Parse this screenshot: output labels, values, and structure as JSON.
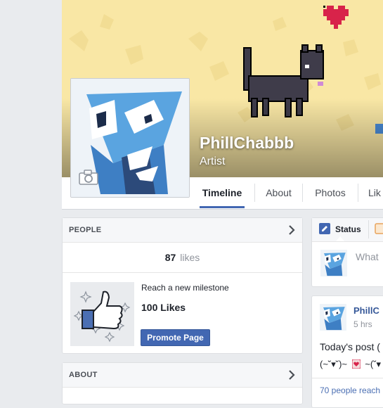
{
  "page": {
    "name": "PhillChabbb",
    "category": "Artist"
  },
  "tabs": [
    {
      "label": "Timeline",
      "active": true
    },
    {
      "label": "About",
      "active": false
    },
    {
      "label": "Photos",
      "active": false
    },
    {
      "label": "Lik",
      "active": false
    }
  ],
  "people_card": {
    "title": "PEOPLE",
    "likes_count": "87",
    "likes_label": "likes",
    "milestone_text": "Reach a new milestone",
    "milestone_goal": "100 Likes",
    "promote_label": "Promote Page"
  },
  "about_card": {
    "title": "ABOUT"
  },
  "composer": {
    "status_tab": "Status",
    "placeholder": "What"
  },
  "post": {
    "author": "PhillC",
    "time": "5 hrs",
    "text_line1": "Today's post (",
    "text_line2": "(~˘▾˘)~",
    "text_line3": "~(˘▾",
    "reach": "70 people reach"
  },
  "colors": {
    "brand_blue": "#4267b2",
    "cover_yellow": "#f9e7a5",
    "heart_red": "#d8234a",
    "cat_dark": "#3f3c4a"
  },
  "icons": [
    "camera-icon",
    "chevron-right-icon",
    "pencil-icon",
    "photo-icon",
    "heart-icon"
  ]
}
